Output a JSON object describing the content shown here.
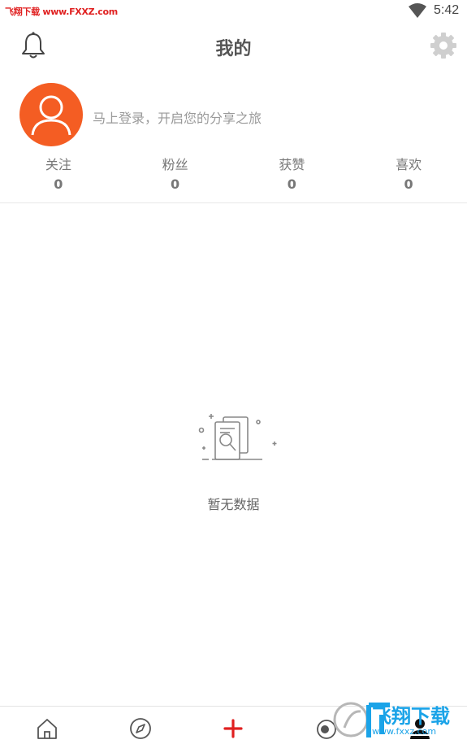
{
  "status_bar": {
    "watermark": "飞翔下载 www.FXXZ.com",
    "time": "5:42"
  },
  "header": {
    "title": "我的",
    "icons": {
      "left": "bell-icon",
      "right": "gear-icon"
    }
  },
  "profile": {
    "login_hint": "马上登录，开启您的分享之旅",
    "avatar": "default-avatar",
    "avatar_color": "#f45d23"
  },
  "stats": [
    {
      "label": "关注",
      "value": "0"
    },
    {
      "label": "粉丝",
      "value": "0"
    },
    {
      "label": "获赞",
      "value": "0"
    },
    {
      "label": "喜欢",
      "value": "0"
    }
  ],
  "empty_state": {
    "icon": "empty-documents-icon",
    "text": "暂无数据"
  },
  "bottom_nav": {
    "items": [
      {
        "icon": "home-icon"
      },
      {
        "icon": "compass-icon"
      },
      {
        "icon": "plus-icon",
        "color": "#e02020"
      },
      {
        "icon": "eye-icon"
      },
      {
        "icon": "user-icon",
        "active": true
      }
    ]
  },
  "watermark_logo": {
    "text": "飞翔下载",
    "url": "www.fxxz.com",
    "color": "#1aa3e8"
  }
}
